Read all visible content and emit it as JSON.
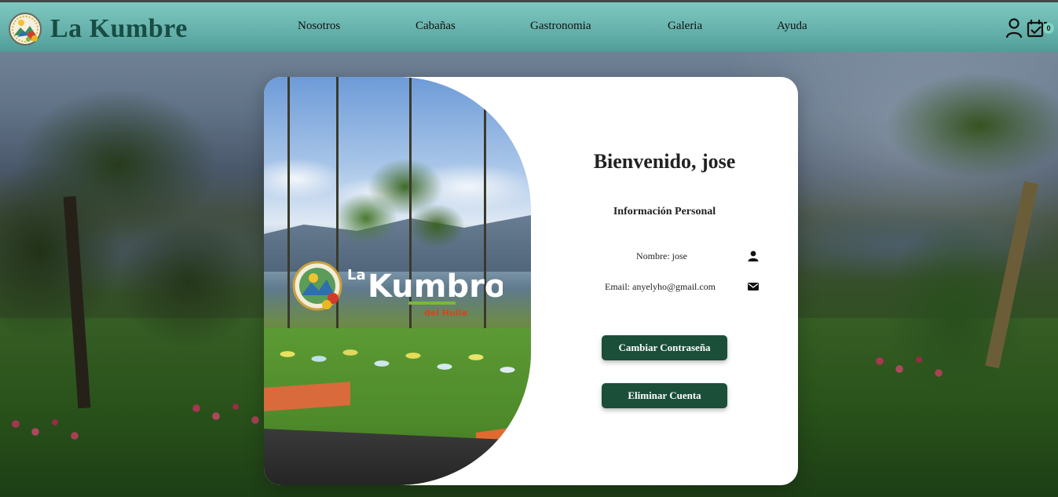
{
  "header": {
    "brand": "La Kumbre",
    "nav": [
      "Nosotros",
      "Cabañas",
      "Gastronomia",
      "Galeria",
      "Ayuda"
    ],
    "icons": {
      "user": "user-icon",
      "cart": "cart-icon"
    },
    "cart_count": "0"
  },
  "card": {
    "welcome": "Bienvenido, jose",
    "section_title": "Información Personal",
    "name_line": "Nombre: jose",
    "email_line": "Email: anyelyho@gmail.com",
    "icons": {
      "name": "person-icon",
      "email": "mail-icon"
    },
    "change_password_button": "Cambiar Contraseña",
    "delete_account_button": "Eliminar Cuenta",
    "photo": {
      "sign_main": "Kumbro",
      "sign_small": "La",
      "sign_sub": "del Huila"
    }
  },
  "colors": {
    "header_teal": "#67b2ac",
    "brand_text": "#174d44",
    "button_green": "#1b4f3a",
    "card_bg": "#ffffff"
  }
}
